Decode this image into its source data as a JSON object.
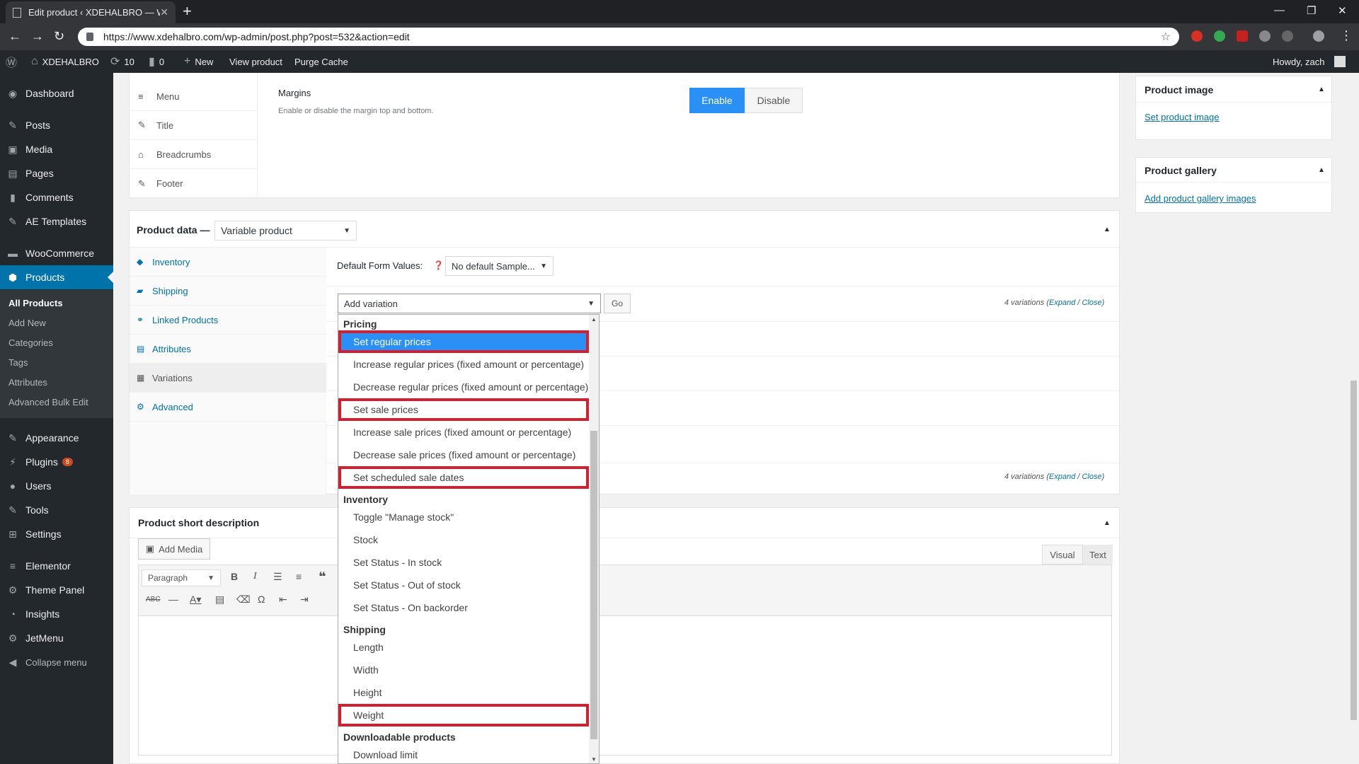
{
  "browser": {
    "tab_title": "Edit product ‹ XDEHALBRO — W",
    "url": "https://www.xdehalbro.com/wp-admin/post.php?post=532&action=edit"
  },
  "adminbar": {
    "site_name": "XDEHALBRO",
    "updates": "10",
    "comments": "0",
    "new_label": "New",
    "view_product": "View product",
    "purge_cache": "Purge Cache",
    "howdy": "Howdy, zach"
  },
  "sidebar": {
    "items": [
      {
        "label": "Dashboard",
        "icon": "dashboard-icon"
      },
      {
        "label": "Posts",
        "icon": "pin-icon"
      },
      {
        "label": "Media",
        "icon": "media-icon"
      },
      {
        "label": "Pages",
        "icon": "pages-icon"
      },
      {
        "label": "Comments",
        "icon": "comment-icon"
      },
      {
        "label": "AE Templates",
        "icon": "pin-icon"
      },
      {
        "label": "WooCommerce",
        "icon": "woo-icon"
      },
      {
        "label": "Products",
        "icon": "product-icon"
      },
      {
        "label": "Appearance",
        "icon": "brush-icon"
      },
      {
        "label": "Plugins",
        "icon": "plugin-icon"
      },
      {
        "label": "Users",
        "icon": "user-icon"
      },
      {
        "label": "Tools",
        "icon": "wrench-icon"
      },
      {
        "label": "Settings",
        "icon": "settings-icon"
      },
      {
        "label": "Elementor",
        "icon": "elementor-icon"
      },
      {
        "label": "Theme Panel",
        "icon": "gear-icon"
      },
      {
        "label": "Insights",
        "icon": "insights-icon"
      },
      {
        "label": "JetMenu",
        "icon": "gear-icon"
      },
      {
        "label": "Collapse menu",
        "icon": "collapse-icon"
      }
    ],
    "plugins_badge": "8",
    "submenu": [
      "All Products",
      "Add New",
      "Categories",
      "Tags",
      "Attributes",
      "Advanced Bulk Edit"
    ]
  },
  "elementor_panel": {
    "nav": [
      "Menu",
      "Title",
      "Breadcrumbs",
      "Footer"
    ],
    "margins_label": "Margins",
    "margins_desc": "Enable or disable the margin top and bottom.",
    "enable": "Enable",
    "disable": "Disable"
  },
  "product_data": {
    "label": "Product data —",
    "type": "Variable product",
    "tabs": [
      "Inventory",
      "Shipping",
      "Linked Products",
      "Attributes",
      "Variations",
      "Advanced"
    ],
    "default_form_values": "Default Form Values:",
    "default_select": "No default Sample...",
    "add_variation": "Add variation",
    "go": "Go",
    "variations_count": "4 variations",
    "expand": "Expand",
    "close": "Close"
  },
  "dropdown": {
    "groups": [
      "Pricing",
      "Inventory",
      "Shipping",
      "Downloadable products"
    ],
    "pricing": [
      "Set regular prices",
      "Increase regular prices (fixed amount or percentage)",
      "Decrease regular prices (fixed amount or percentage)",
      "Set sale prices",
      "Increase sale prices (fixed amount or percentage)",
      "Decrease sale prices (fixed amount or percentage)",
      "Set scheduled sale dates"
    ],
    "inventory": [
      "Toggle \"Manage stock\"",
      "Stock",
      "Set Status - In stock",
      "Set Status - Out of stock",
      "Set Status - On backorder"
    ],
    "shipping": [
      "Length",
      "Width",
      "Height",
      "Weight"
    ],
    "downloadable": [
      "Download limit"
    ]
  },
  "short_desc": {
    "title": "Product short description",
    "add_media": "Add Media",
    "format": "Paragraph",
    "visual": "Visual",
    "text": "Text"
  },
  "side": {
    "product_image": "Product image",
    "set_product_image": "Set product image",
    "product_gallery": "Product gallery",
    "add_gallery": "Add product gallery images"
  },
  "colors": {
    "accent": "#0073aa",
    "highlight": "#2b90f5",
    "callout": "#d2202f",
    "enable": "#2b90f5"
  }
}
